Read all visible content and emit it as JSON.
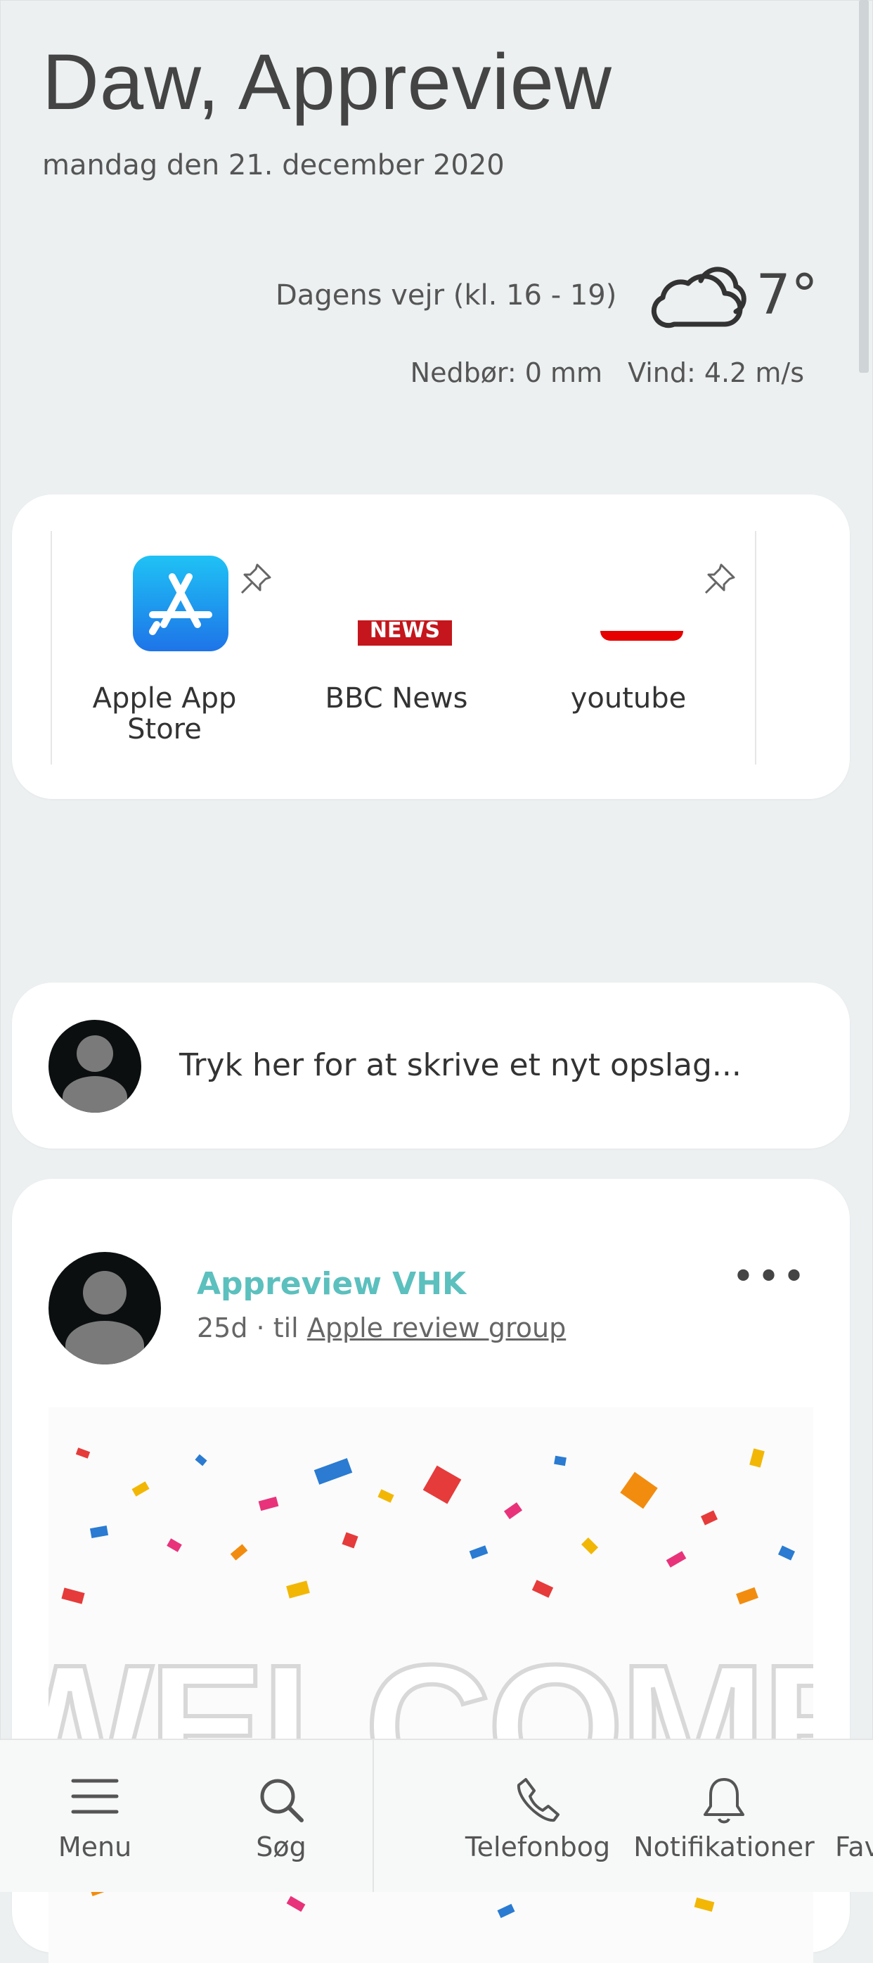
{
  "header": {
    "greeting": "Daw, Appreview",
    "date": "mandag den 21. december 2020"
  },
  "weather": {
    "label": "Dagens vejr (kl. 16 - 19)",
    "icon": "cloud-icon",
    "temperature": "7°",
    "precipitation": "Nedbør: 0 mm",
    "wind": "Vind: 4.2 m/s"
  },
  "apps": [
    {
      "label": "Apple App Store",
      "icon": "app-store-icon",
      "pinned": true
    },
    {
      "label": "BBC News",
      "icon": "bbc-news-icon",
      "icon_text": "NEWS",
      "pinned": false
    },
    {
      "label": "youtube",
      "icon": "youtube-icon",
      "pinned": true
    }
  ],
  "compose": {
    "placeholder": "Tryk her for at skrive et nyt opslag..."
  },
  "post": {
    "author": "Appreview VHK",
    "age": "25d · til",
    "group": "Apple review group",
    "image_text": "WELCOME"
  },
  "bottom_nav": [
    {
      "label": "Menu",
      "icon": "menu-icon"
    },
    {
      "label": "Søg",
      "icon": "search-icon"
    },
    {
      "label": "Telefonbog",
      "icon": "phone-icon"
    },
    {
      "label": "Notifikationer",
      "icon": "bell-icon"
    },
    {
      "label": "Fav",
      "icon": "star-icon"
    }
  ],
  "colors": {
    "background": "#ecf0f1",
    "accent": "#5bc0be",
    "card": "#ffffff"
  }
}
